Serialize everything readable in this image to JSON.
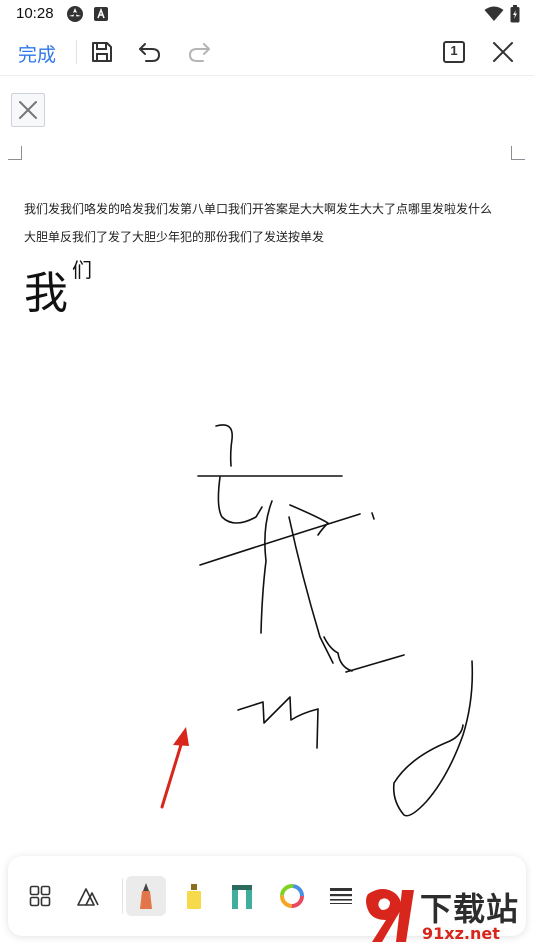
{
  "status_bar": {
    "time": "10:28",
    "left_icons": [
      "sync-icon",
      "a-badge-icon"
    ],
    "right_icons": [
      "wifi-icon",
      "battery-icon"
    ]
  },
  "toolbar": {
    "done_label": "完成",
    "icons": [
      "save-icon",
      "undo-icon",
      "redo-icon",
      "page-count-icon",
      "close-icon"
    ],
    "page_number": "1",
    "accent_color": "#2f78e8"
  },
  "document": {
    "lines": [
      "我们发我们咯发的哈发我们发第八单口我们开答案是大大啊发生大大了点哪里发啦发什么",
      "大胆单反我们了发了大胆少年犯的那份我们了发送按单发"
    ],
    "large_char": "我",
    "superscript_char": "们"
  },
  "pen_toolbar": {
    "tools": [
      "apps-icon",
      "shapes-icon",
      "pen-icon",
      "highlighter-icon",
      "marker-icon",
      "color-wheel-icon",
      "line-weight-icon"
    ],
    "selected_tool": "pen-icon",
    "pen_color": "#e2764a",
    "highlighter_color": "#f7d94c",
    "marker_color": "#3fae9c"
  },
  "watermark": {
    "title": "下载站",
    "url": "91xz.net",
    "brand_color": "#d8261c"
  }
}
